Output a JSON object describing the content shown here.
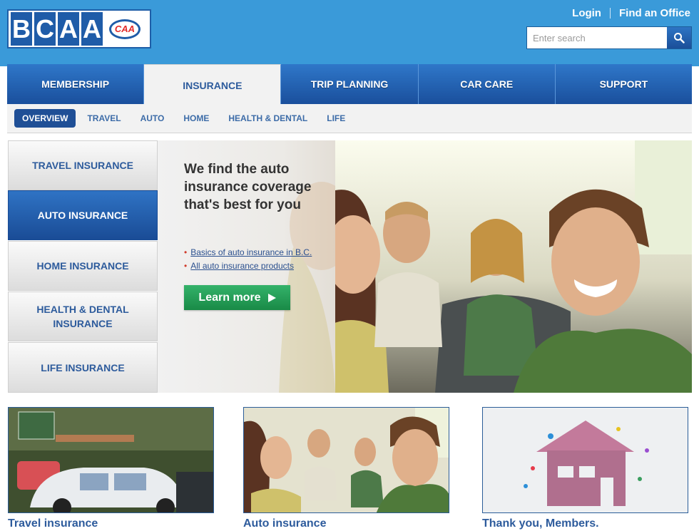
{
  "header": {
    "logo_letters": [
      "B",
      "C",
      "A",
      "A"
    ],
    "logo_badge": "CAA",
    "login": "Login",
    "find_office": "Find an Office",
    "search_placeholder": "Enter search"
  },
  "main_nav": [
    {
      "label": "MEMBERSHIP"
    },
    {
      "label": "INSURANCE",
      "active": true
    },
    {
      "label": "TRIP PLANNING"
    },
    {
      "label": "CAR CARE"
    },
    {
      "label": "SUPPORT"
    }
  ],
  "sub_nav": [
    {
      "label": "OVERVIEW",
      "active": true
    },
    {
      "label": "TRAVEL"
    },
    {
      "label": "AUTO"
    },
    {
      "label": "HOME"
    },
    {
      "label": "HEALTH & DENTAL"
    },
    {
      "label": "LIFE"
    }
  ],
  "left_menu": [
    {
      "label": "TRAVEL INSURANCE"
    },
    {
      "label": "AUTO INSURANCE",
      "active": true
    },
    {
      "label": "HOME INSURANCE"
    },
    {
      "label": "HEALTH & DENTAL INSURANCE"
    },
    {
      "label": "LIFE INSURANCE"
    }
  ],
  "hero": {
    "headline": "We find the auto insurance coverage that's best for you",
    "links": [
      "Basics of auto insurance in B.C.",
      "All auto insurance products"
    ],
    "button": "Learn more"
  },
  "promos": [
    {
      "caption": "Travel insurance"
    },
    {
      "caption": "Auto insurance"
    },
    {
      "caption": "Thank you, Members."
    }
  ],
  "colors": {
    "header_blue": "#3a9ad9",
    "nav_blue": "#2160ad",
    "link_blue": "#2d5b9c",
    "cta_green": "#1f9a52"
  }
}
